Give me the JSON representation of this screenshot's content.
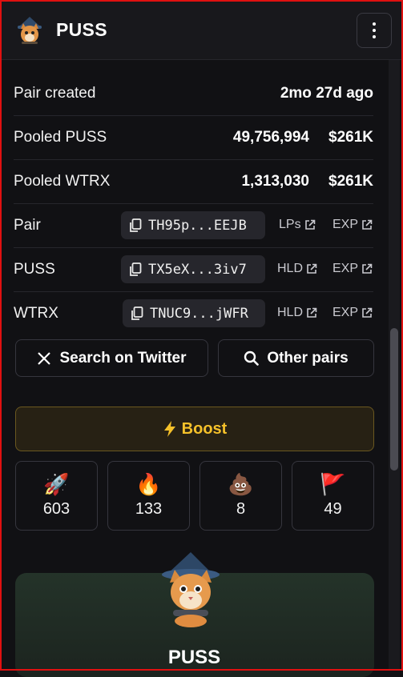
{
  "header": {
    "title": "PUSS",
    "menu_icon": "more-vertical-icon"
  },
  "info": {
    "pair_created": {
      "label": "Pair created",
      "value": "2mo 27d ago"
    },
    "pooled_puss": {
      "label": "Pooled PUSS",
      "amount": "49,756,994",
      "usd": "$261K"
    },
    "pooled_wtrx": {
      "label": "Pooled WTRX",
      "amount": "1,313,030",
      "usd": "$261K"
    },
    "pair": {
      "label": "Pair",
      "address": "TH95p...EEJB",
      "link1": "LPs",
      "link2": "EXP"
    },
    "puss": {
      "label": "PUSS",
      "address": "TX5eX...3iv7",
      "link1": "HLD",
      "link2": "EXP"
    },
    "wtrx": {
      "label": "WTRX",
      "address": "TNUC9...jWFR",
      "link1": "HLD",
      "link2": "EXP"
    }
  },
  "actions": {
    "twitter": "Search on Twitter",
    "other_pairs": "Other pairs",
    "boost": "Boost"
  },
  "reactions": [
    {
      "emoji": "🚀",
      "count": "603"
    },
    {
      "emoji": "🔥",
      "count": "133"
    },
    {
      "emoji": "💩",
      "count": "8"
    },
    {
      "emoji": "🚩",
      "count": "49"
    }
  ],
  "token_card": {
    "name": "PUSS"
  },
  "colors": {
    "accent": "#f5c12a",
    "frame": "#e01010",
    "background": "#111114"
  }
}
